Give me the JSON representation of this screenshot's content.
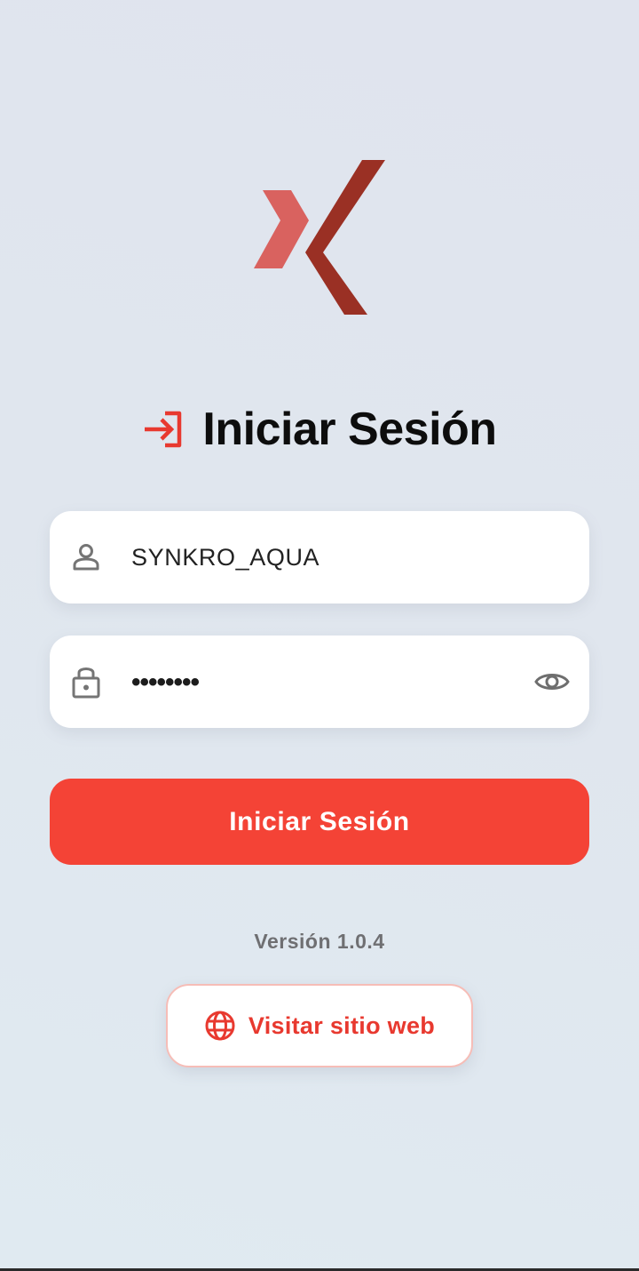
{
  "brand": {
    "logo_icon": "x-chevron-logo-icon",
    "logo_light_color": "#d9625f",
    "logo_dark_color": "#9a3024"
  },
  "header": {
    "title": "Iniciar Sesión",
    "title_icon": "login-arrow-icon"
  },
  "form": {
    "username": {
      "value": "SYNKRO_AQUA",
      "icon": "person-icon"
    },
    "password": {
      "masked_value": "••••••••",
      "icon": "lock-icon",
      "toggle_icon": "eye-icon"
    },
    "submit_label": "Iniciar Sesión"
  },
  "footer": {
    "version": "Versión 1.0.4",
    "website_button_label": "Visitar sitio web",
    "website_icon": "globe-icon"
  },
  "colors": {
    "accent": "#f44336",
    "accent_text": "#e8392f",
    "website_border": "#f6bdb7",
    "background": "#e0e6ee"
  }
}
